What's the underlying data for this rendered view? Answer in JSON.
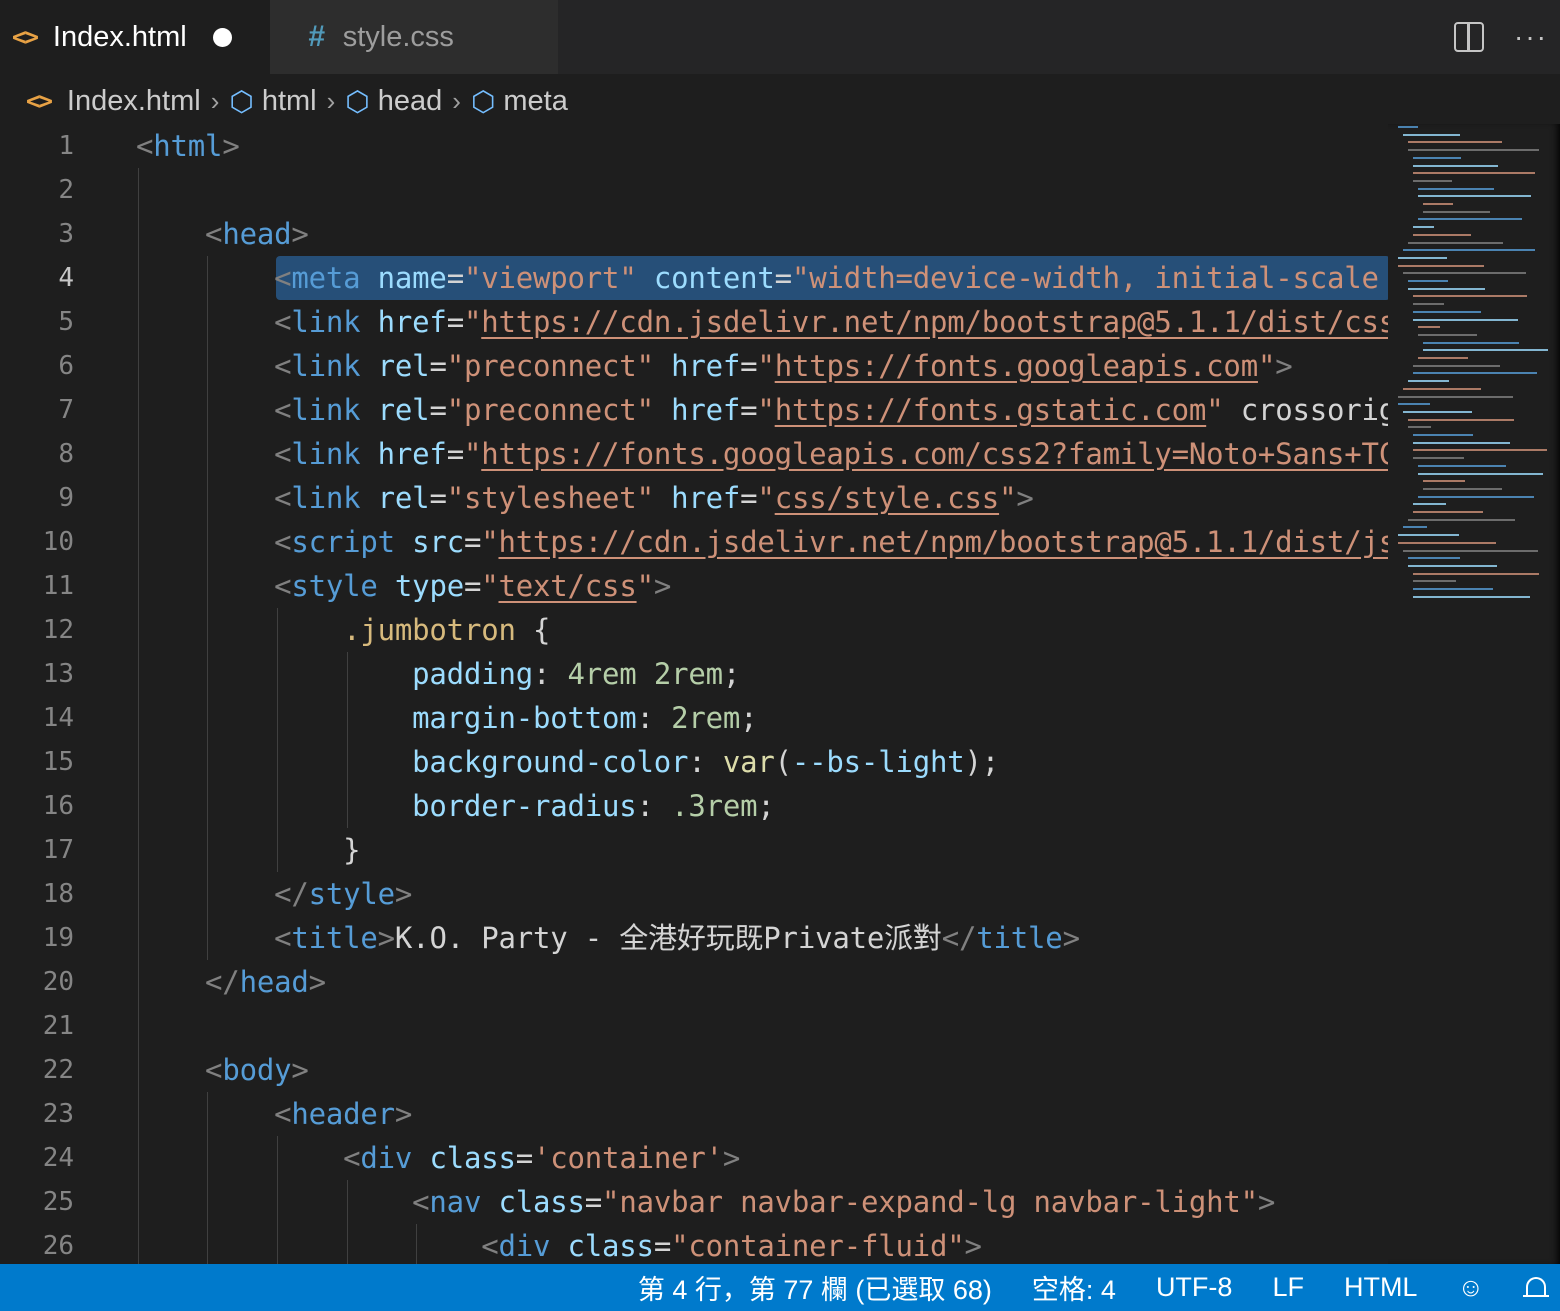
{
  "tabs": [
    {
      "label": "Index.html",
      "icon": "html-file-icon",
      "active": true,
      "dirty": true
    },
    {
      "label": "style.css",
      "icon": "css-file-icon",
      "active": false
    }
  ],
  "tab_actions": {
    "more_label": "···"
  },
  "breadcrumb": [
    {
      "label": "Index.html",
      "icon": "html-file-icon"
    },
    {
      "label": "html",
      "icon": "cube-icon"
    },
    {
      "label": "head",
      "icon": "cube-icon"
    },
    {
      "label": "meta",
      "icon": "cube-icon"
    }
  ],
  "editor": {
    "current_line": 4,
    "line_numbers": [
      "1",
      "2",
      "3",
      "4",
      "5",
      "6",
      "7",
      "8",
      "9",
      "10",
      "11",
      "12",
      "13",
      "14",
      "15",
      "16",
      "17",
      "18",
      "19",
      "20",
      "21",
      "22",
      "23",
      "24",
      "25",
      "26"
    ],
    "lines": [
      "<html>",
      "",
      "    <head>",
      "        <meta name=\"viewport\" content=\"width=device-width, initial-scale",
      "        <link href=\"https://cdn.jsdelivr.net/npm/bootstrap@5.1.1/dist/css",
      "        <link rel=\"preconnect\" href=\"https://fonts.googleapis.com\">",
      "        <link rel=\"preconnect\" href=\"https://fonts.gstatic.com\" crossorig",
      "        <link href=\"https://fonts.googleapis.com/css2?family=Noto+Sans+TC",
      "        <link rel=\"stylesheet\" href=\"css/style.css\">",
      "        <script src=\"https://cdn.jsdelivr.net/npm/bootstrap@5.1.1/dist/js",
      "        <style type=\"text/css\">",
      "            .jumbotron {",
      "                padding: 4rem 2rem;",
      "                margin-bottom: 2rem;",
      "                background-color: var(--bs-light);",
      "                border-radius: .3rem;",
      "            }",
      "        </style>",
      "        <title>K.O. Party - 全港好玩既Private派對</title>",
      "    </head>",
      "",
      "    <body>",
      "        <header>",
      "            <div class='container'>",
      "                <nav class=\"navbar navbar-expand-lg navbar-light\">",
      "                    <div class=\"container-fluid\">"
    ]
  },
  "status_bar": {
    "cursor": "第 4 行，第 77 欄 (已選取 68)",
    "indent": "空格: 4",
    "encoding": "UTF-8",
    "eol": "LF",
    "language": "HTML"
  },
  "colors": {
    "editor_bg": "#1e1e1e",
    "tabbar_bg": "#252526",
    "statusbar_bg": "#007acc",
    "selection_bg": "#264f78",
    "tag": "#569cd6",
    "attribute": "#9cdcfe",
    "string": "#ce9178",
    "bracket": "#808080",
    "css_selector": "#d7ba7d",
    "number": "#b5cea8",
    "function": "#dcdcaa",
    "html_icon": "#e8a245",
    "css_icon": "#519aba"
  }
}
